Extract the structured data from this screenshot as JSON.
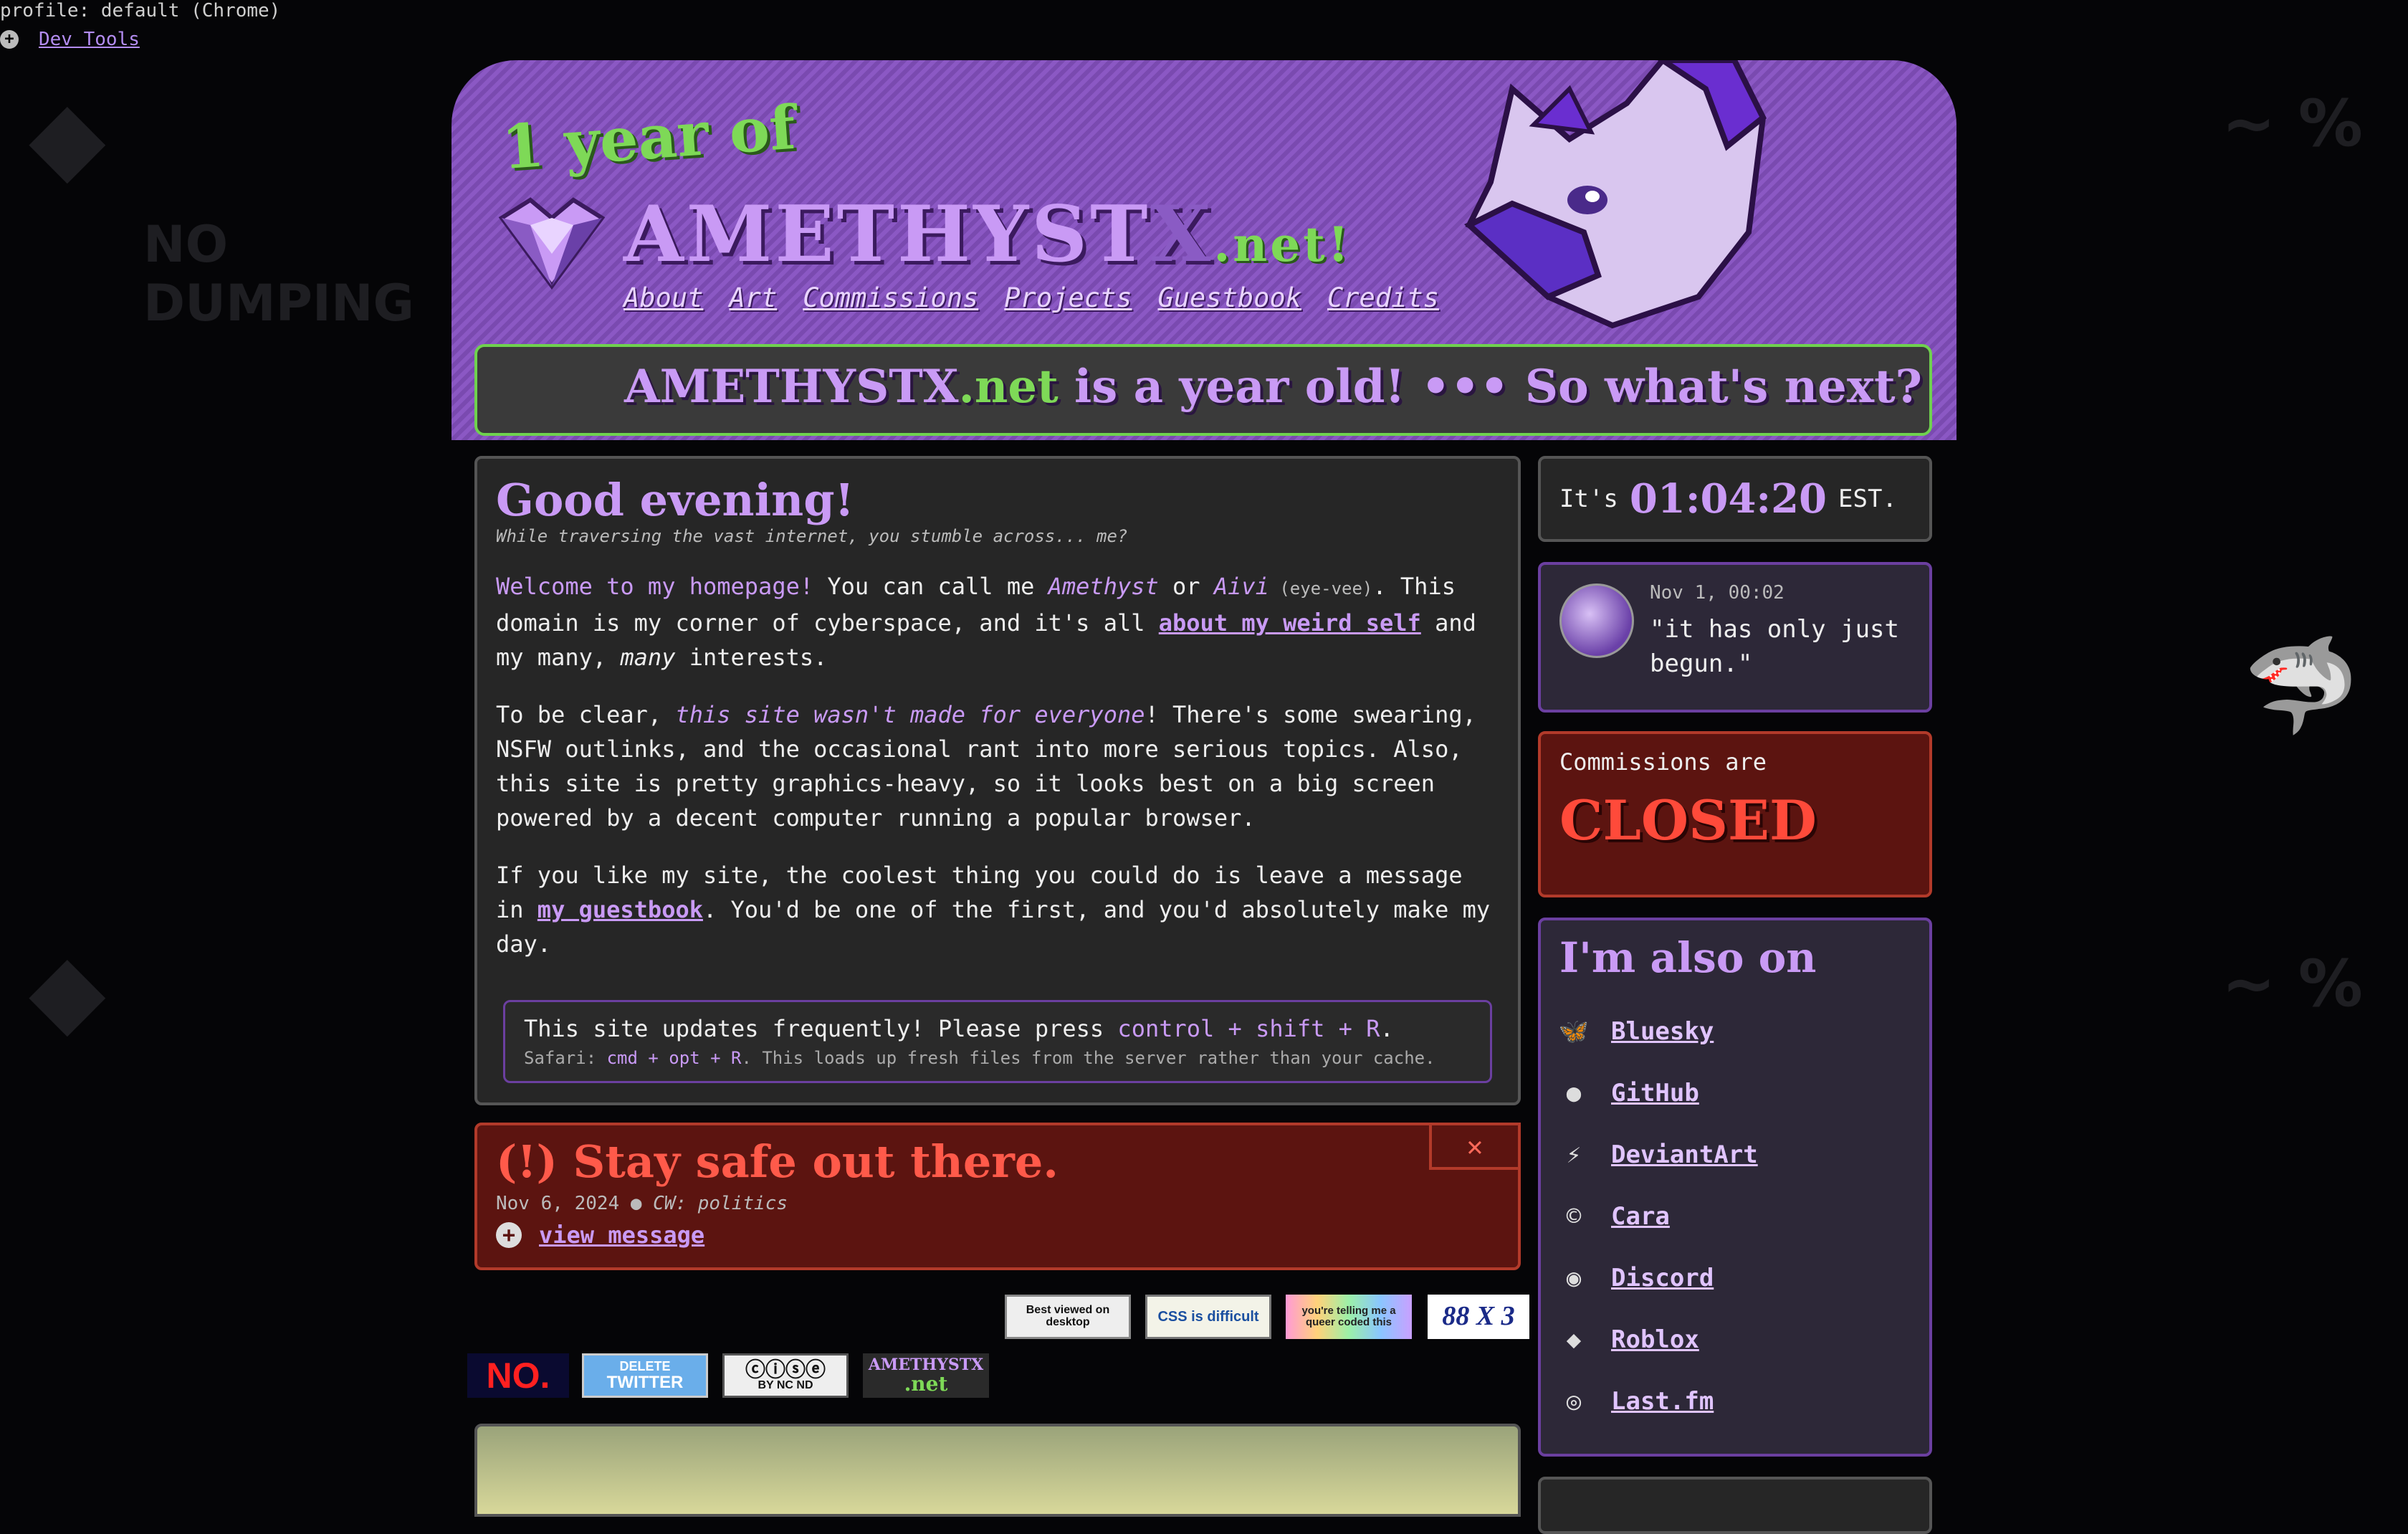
{
  "devtools": {
    "profile": "profile: default (Chrome)",
    "link": "Dev Tools"
  },
  "header": {
    "year_text": "1 year of",
    "site_main": "AMETHYST",
    "site_x": "X",
    "site_net": ".net!",
    "nav": [
      "About",
      "Art",
      "Commissions",
      "Projects",
      "Guestbook",
      "Credits"
    ]
  },
  "ticker": {
    "site": "AMETHYSTX",
    "net": ".net",
    "text": " is a year old! ••• So what's next? ••• Ex"
  },
  "welcome": {
    "title": "Good evening!",
    "subtitle": "While traversing the vast internet, you stumble across... me?",
    "p1_intro": "Welcome to my homepage!",
    "p1_a": " You can call me ",
    "p1_name1": "Amethyst",
    "p1_or": " or ",
    "p1_name2": "Aivi",
    "p1_pron": " (eye-vee)",
    "p1_b": ". This domain is my corner of cyberspace, and it's all ",
    "p1_link": "about my weird self",
    "p1_c": " and my many, ",
    "p1_many": "many",
    "p1_d": " interests.",
    "p2_a": "To be clear, ",
    "p2_hl": "this site wasn't made for everyone",
    "p2_b": "! There's some swearing, NSFW outlinks, and the occasional rant into more serious topics. Also, this site is pretty graphics-heavy, so it looks best on a big screen powered by a decent computer running a popular browser.",
    "p3_a": "If you like my site, the coolest thing you could do is leave a message in ",
    "p3_link": "my guestbook",
    "p3_b": ". You'd be one of the first, and you'd absolutely make my day.",
    "note1_a": "This site updates frequently! Please press ",
    "note1_keys": "control + shift + R",
    "note1_b": ".",
    "note2_a": "Safari: ",
    "note2_keys": "cmd + opt + R",
    "note2_b": ". This loads up fresh files from the server rather than your cache."
  },
  "alert": {
    "title": "(!) Stay safe out there.",
    "date": "Nov 6, 2024",
    "sep": " ● ",
    "cw": "CW: politics",
    "view": "view message",
    "close": "✕"
  },
  "badges": {
    "desktop": "Best viewed on desktop",
    "css": "CSS is difficult",
    "queer": "you're telling me a queer coded this",
    "b88": "88 X 3",
    "no": "NO.",
    "twitter_1": "DELETE",
    "twitter_2": "TWITTER",
    "cc": "BY NC ND",
    "amx_1": "AMETHYSTX",
    "amx_2": ".net"
  },
  "clock": {
    "prefix": "It's",
    "time": "01:04:20",
    "tz": "EST."
  },
  "status": {
    "date": "Nov 1, 00:02",
    "text": "\"it has only just begun.\""
  },
  "commissions": {
    "label": "Commissions are",
    "state": "CLOSED"
  },
  "social": {
    "title": "I'm also on",
    "items": [
      {
        "icon": "bluesky-icon",
        "label": "Bluesky"
      },
      {
        "icon": "github-icon",
        "label": "GitHub"
      },
      {
        "icon": "deviantart-icon",
        "label": "DeviantArt"
      },
      {
        "icon": "cara-icon",
        "label": "Cara"
      },
      {
        "icon": "discord-icon",
        "label": "Discord"
      },
      {
        "icon": "roblox-icon",
        "label": "Roblox"
      },
      {
        "icon": "lastfm-icon",
        "label": "Last.fm"
      }
    ]
  },
  "colors": {
    "accent": "#c99af5",
    "green": "#7ed957",
    "alert": "#ff5a4a"
  }
}
